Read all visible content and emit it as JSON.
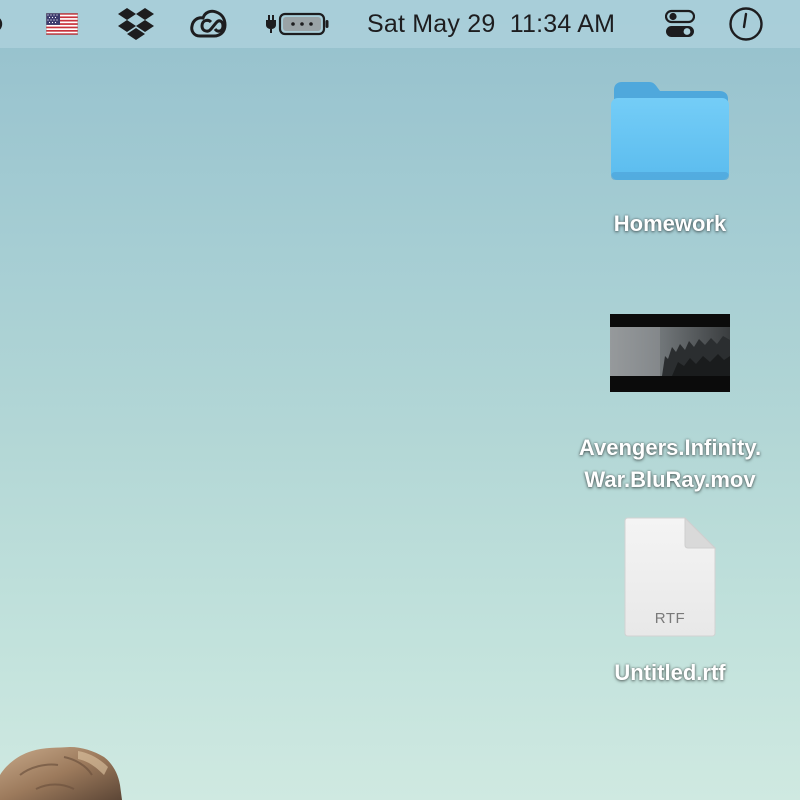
{
  "menubar": {
    "input_source_icon": "us-flag-icon",
    "dropbox_icon": "dropbox-icon",
    "creative_cloud_icon": "creative-cloud-icon",
    "battery_icon": "battery-charging-icon",
    "datetime": "Sat May 29  11:34 AM",
    "control_center_icon": "control-center-icon",
    "clock_icon": "clock-icon"
  },
  "desktop": {
    "items": [
      {
        "type": "folder",
        "icon": "folder-icon",
        "label": "Homework"
      },
      {
        "type": "video",
        "icon": "video-thumbnail",
        "label_line1": "Avengers.Infinity.",
        "label_line2": "War.BluRay.mov"
      },
      {
        "type": "document",
        "icon": "rtf-document-icon",
        "badge": "RTF",
        "label": "Untitled.rtf"
      }
    ]
  },
  "colors": {
    "folder_blue": "#6ac8f5",
    "folder_tab": "#5bb4e6",
    "menubar_text": "#1d1d1f"
  }
}
